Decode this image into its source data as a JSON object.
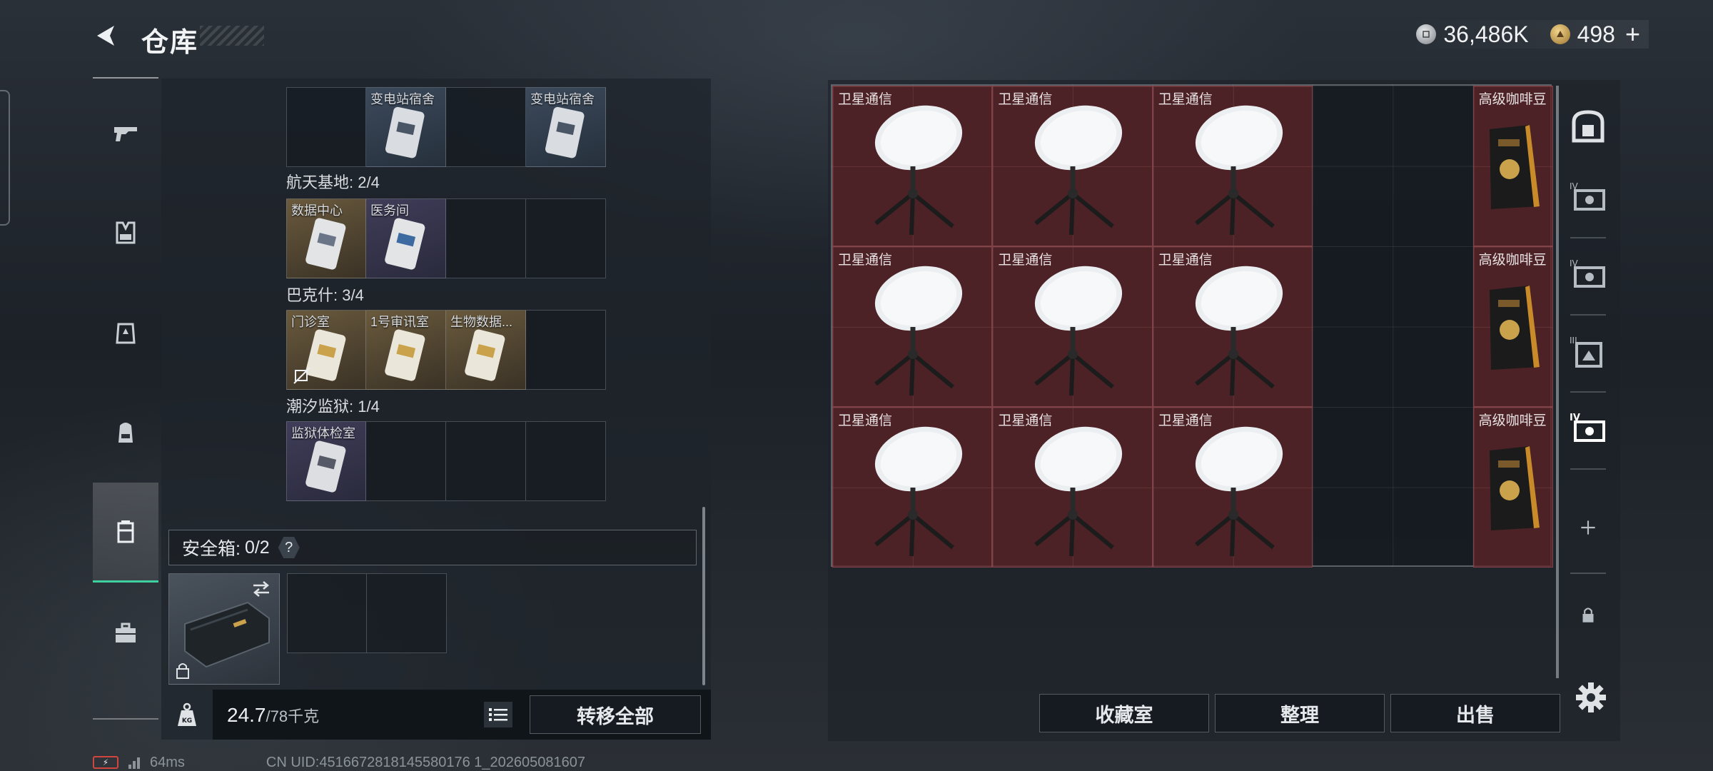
{
  "header": {
    "title": "仓库",
    "currency": [
      {
        "icon": "silver-coin-icon",
        "value": "36,486K"
      },
      {
        "icon": "gold-coin-icon",
        "value": "498"
      }
    ],
    "plus": "+"
  },
  "left_nav": {
    "items": [
      "gun-icon",
      "vest-icon",
      "armor-icon",
      "backpack-icon",
      "container-icon",
      "toolbox-icon"
    ],
    "active": "container-icon"
  },
  "keycards": {
    "row0": [
      "",
      "变电站宿舍",
      "",
      "变电站宿舍"
    ],
    "groups": [
      {
        "label": "航天基地: 2/4",
        "cells": [
          "数据中心",
          "医务间",
          "",
          ""
        ]
      },
      {
        "label": "巴克什: 3/4",
        "cells": [
          "门诊室",
          "1号审讯室",
          "生物数据...",
          ""
        ]
      },
      {
        "label": "潮汐监狱: 1/4",
        "cells": [
          "监狱体检室",
          "",
          "",
          ""
        ]
      }
    ]
  },
  "safe": {
    "label": "安全箱:",
    "count": "0/2",
    "help": "?"
  },
  "weight": {
    "current": "24.7",
    "max": "/78千克"
  },
  "buttons": {
    "transfer_all": "转移全部",
    "collection": "收藏室",
    "organize": "整理",
    "sell": "出售"
  },
  "stash_items": [
    {
      "name": "卫星通信"
    },
    {
      "name": "卫星通信"
    },
    {
      "name": "卫星通信"
    },
    {
      "name": "卫星通信"
    },
    {
      "name": "卫星通信"
    },
    {
      "name": "卫星通信"
    },
    {
      "name": "卫星通信"
    },
    {
      "name": "卫星通信"
    },
    {
      "name": "卫星通信"
    },
    {
      "name": "高级咖啡豆"
    },
    {
      "name": "高级咖啡豆"
    },
    {
      "name": "高级咖啡豆"
    }
  ],
  "right_sidebar": [
    "safe-icon",
    "tier-iv-case-icon",
    "tier-iv-case-icon",
    "tier-iii-case-icon",
    "tier-iv-case-icon",
    "add-icon",
    "lock-icon"
  ],
  "footer": {
    "ping": "64ms",
    "uid": "CN UID:4516672818145580176 1_202605081607"
  },
  "colors": {
    "item_bg": "#5c2428",
    "accent": "#3fd0a0"
  }
}
